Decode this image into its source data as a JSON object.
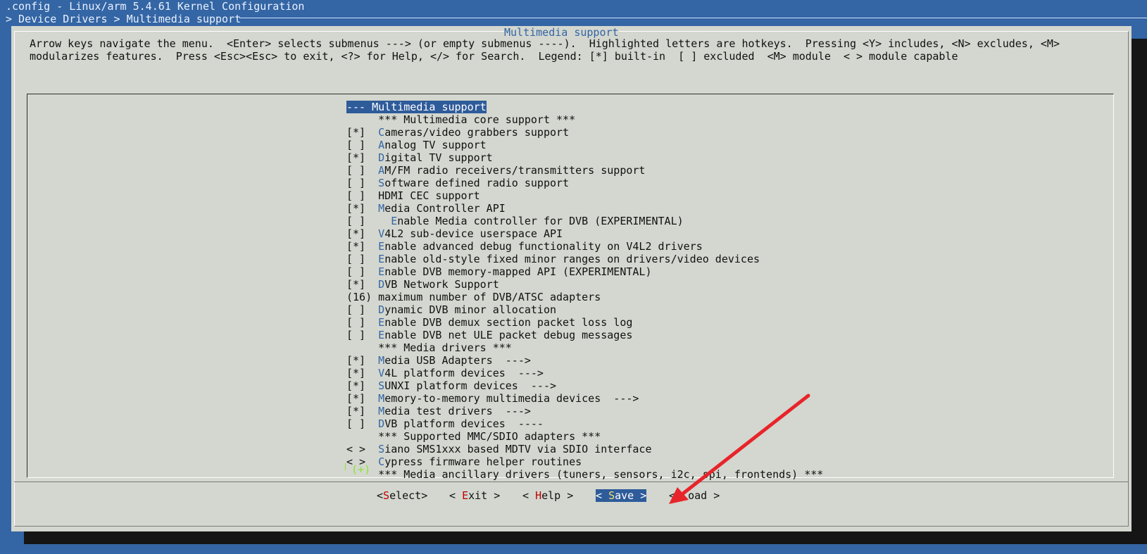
{
  "window": {
    "title": ".config - Linux/arm 5.4.61 Kernel Configuration",
    "breadcrumb": "> Device Drivers > Multimedia support"
  },
  "dialog": {
    "title": "Multimedia support",
    "help_line1": "Arrow keys navigate the menu.  <Enter> selects submenus ---> (or empty submenus ----).  Highlighted letters are hotkeys.  Pressing <Y> includes, <N> excludes, <M>",
    "help_line2": "modularizes features.  Press <Esc><Esc> to exit, <?> for Help, </> for Search.  Legend: [*] built-in  [ ] excluded  <M> module  < > module capable"
  },
  "menu": {
    "items": [
      {
        "prefix": "",
        "indent": "",
        "hotkey": "",
        "label": "--- Multimedia support",
        "selected": true
      },
      {
        "prefix": "     ",
        "indent": "",
        "hotkey": "",
        "label": "*** Multimedia core support ***"
      },
      {
        "prefix": "[*]  ",
        "indent": "",
        "hotkey": "C",
        "label": "ameras/video grabbers support"
      },
      {
        "prefix": "[ ]  ",
        "indent": "",
        "hotkey": "A",
        "label": "nalog TV support"
      },
      {
        "prefix": "[*]  ",
        "indent": "",
        "hotkey": "D",
        "label": "igital TV support"
      },
      {
        "prefix": "[ ]  ",
        "indent": "",
        "hotkey": "A",
        "label": "M/FM radio receivers/transmitters support"
      },
      {
        "prefix": "[ ]  ",
        "indent": "",
        "hotkey": "S",
        "label": "oftware defined radio support"
      },
      {
        "prefix": "[ ]  ",
        "indent": "",
        "hotkey": "",
        "label": "HDMI CEC support"
      },
      {
        "prefix": "[*]  ",
        "indent": "",
        "hotkey": "M",
        "label": "edia Controller API"
      },
      {
        "prefix": "[ ]  ",
        "indent": "  ",
        "hotkey": "E",
        "label": "nable Media controller for DVB (EXPERIMENTAL)"
      },
      {
        "prefix": "[*]  ",
        "indent": "",
        "hotkey": "V",
        "label": "4L2 sub-device userspace API"
      },
      {
        "prefix": "[*]  ",
        "indent": "",
        "hotkey": "E",
        "label": "nable advanced debug functionality on V4L2 drivers"
      },
      {
        "prefix": "[ ]  ",
        "indent": "",
        "hotkey": "E",
        "label": "nable old-style fixed minor ranges on drivers/video devices"
      },
      {
        "prefix": "[ ]  ",
        "indent": "",
        "hotkey": "E",
        "label": "nable DVB memory-mapped API (EXPERIMENTAL)"
      },
      {
        "prefix": "[*]  ",
        "indent": "",
        "hotkey": "D",
        "label": "VB Network Support"
      },
      {
        "prefix": "(16) ",
        "indent": "",
        "hotkey": "",
        "label": "maximum number of DVB/ATSC adapters"
      },
      {
        "prefix": "[ ]  ",
        "indent": "",
        "hotkey": "D",
        "label": "ynamic DVB minor allocation"
      },
      {
        "prefix": "[ ]  ",
        "indent": "",
        "hotkey": "E",
        "label": "nable DVB demux section packet loss log"
      },
      {
        "prefix": "[ ]  ",
        "indent": "",
        "hotkey": "E",
        "label": "nable DVB net ULE packet debug messages"
      },
      {
        "prefix": "     ",
        "indent": "",
        "hotkey": "",
        "label": "*** Media drivers ***"
      },
      {
        "prefix": "[*]  ",
        "indent": "",
        "hotkey": "M",
        "label": "edia USB Adapters  --->"
      },
      {
        "prefix": "[*]  ",
        "indent": "",
        "hotkey": "V",
        "label": "4L platform devices  --->"
      },
      {
        "prefix": "[*]  ",
        "indent": "",
        "hotkey": "S",
        "label": "UNXI platform devices  --->"
      },
      {
        "prefix": "[*]  ",
        "indent": "",
        "hotkey": "M",
        "label": "emory-to-memory multimedia devices  --->"
      },
      {
        "prefix": "[*]  ",
        "indent": "",
        "hotkey": "M",
        "label": "edia test drivers  --->"
      },
      {
        "prefix": "[ ]  ",
        "indent": "",
        "hotkey": "D",
        "label": "VB platform devices  ----"
      },
      {
        "prefix": "     ",
        "indent": "",
        "hotkey": "",
        "label": "*** Supported MMC/SDIO adapters ***"
      },
      {
        "prefix": "< >  ",
        "indent": "",
        "hotkey": "S",
        "label": "iano SMS1xxx based MDTV via SDIO interface"
      },
      {
        "prefix": "< >  ",
        "indent": "",
        "hotkey": "C",
        "label": "ypress firmware helper routines"
      },
      {
        "prefix": "     ",
        "indent": "",
        "hotkey": "",
        "label": "*** Media ancillary drivers (tuners, sensors, i2c, spi, frontends) ***"
      }
    ],
    "more_indicator": "(+)"
  },
  "buttons": {
    "select": {
      "pre": "<",
      "hotkey": "S",
      "post": "elect>"
    },
    "exit": {
      "pre": "< ",
      "hotkey": "E",
      "post": "xit >"
    },
    "help": {
      "pre": "< ",
      "hotkey": "H",
      "post": "elp >"
    },
    "save": {
      "pre": "< ",
      "hotkey": "S",
      "post": "ave >"
    },
    "load": {
      "pre": "< ",
      "hotkey": "L",
      "post": "oad >"
    }
  },
  "colors": {
    "background": "#3465a4",
    "dialog": "#d3d7cf",
    "highlight": "#2e5b9a",
    "hotkey_menu": "#3465a4",
    "hotkey_button": "#c00000",
    "annotation_arrow": "#e8242b"
  }
}
